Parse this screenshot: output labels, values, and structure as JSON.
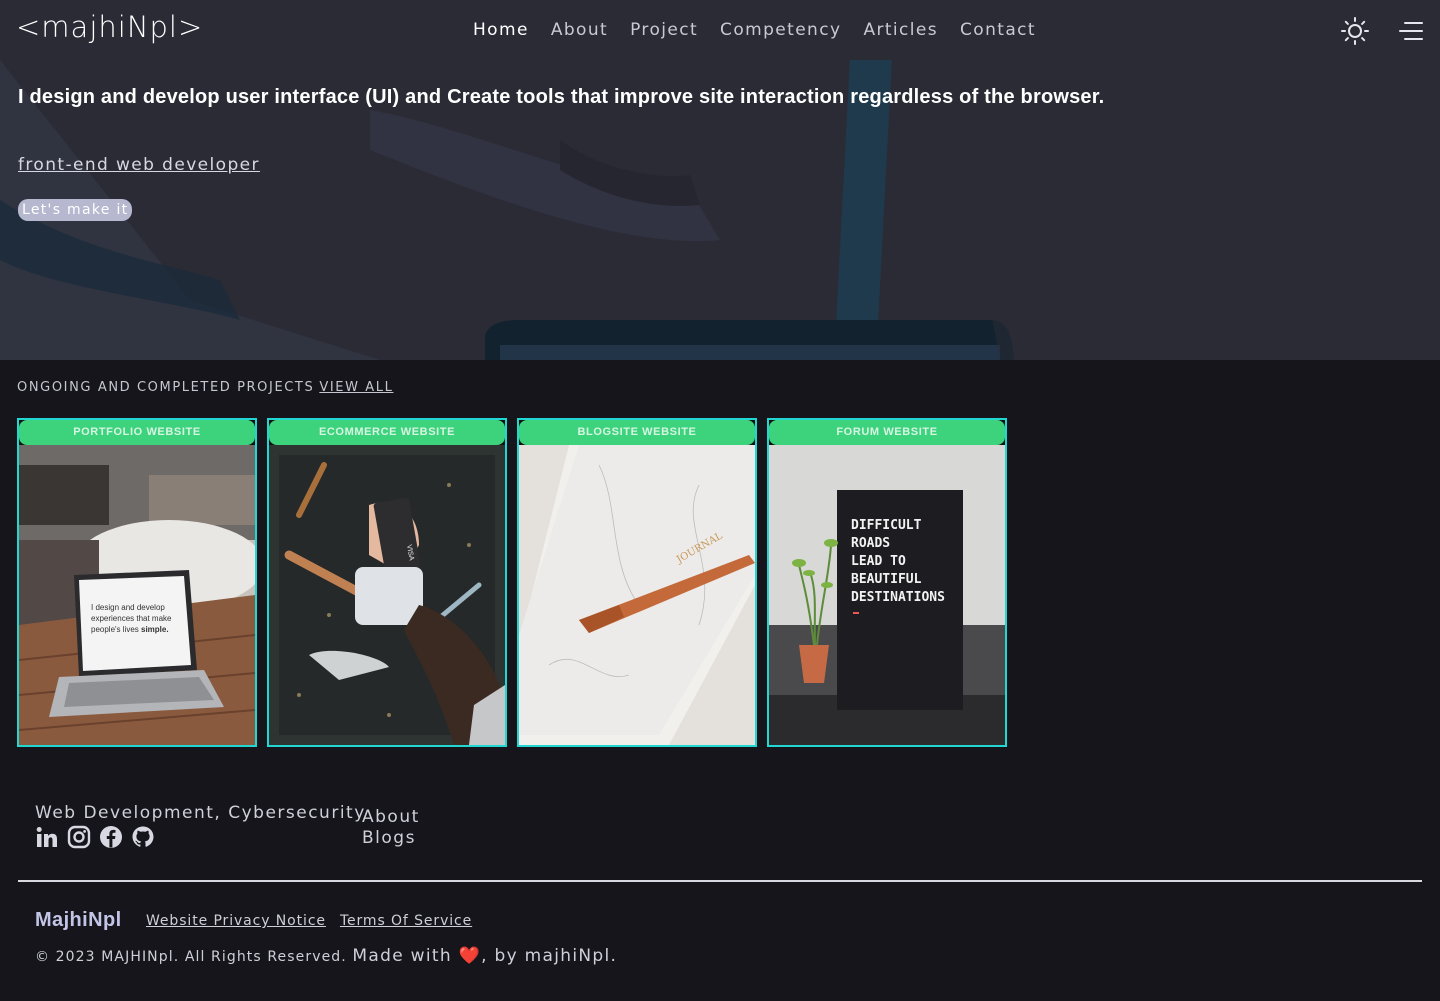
{
  "header": {
    "logo": "<majhiNpl>",
    "nav": [
      "Home",
      "About",
      "Project",
      "Competency",
      "Articles",
      "Contact"
    ],
    "active_nav": "Home",
    "icons": {
      "theme": "sun-icon",
      "menu": "menu-icon"
    }
  },
  "hero": {
    "headline": "I design and develop user interface (UI) and Create tools that improve site interaction regardless of the browser.",
    "role": "front-end web developer",
    "cta": "Let's make it"
  },
  "projects": {
    "heading": "ONGOING AND COMPLETED PROJECTS",
    "view_all": "VIEW ALL",
    "items": [
      {
        "label": "PORTFOLIO WEBSITE",
        "image": "laptop-on-table",
        "image_text": "I design and develop experiences that make people's lives simple."
      },
      {
        "label": "ECOMMERCE WEBSITE",
        "image": "card-payment-workbench",
        "image_text": "VISA"
      },
      {
        "label": "BLOGSITE WEBSITE",
        "image": "journal-and-pen",
        "image_text": "JOURNAL"
      },
      {
        "label": "FORUM WEBSITE",
        "image": "letterboard-and-plant",
        "image_text": "DIFFICULT ROADS LEAD TO BEAUTIFUL DESTINATIONS"
      }
    ]
  },
  "footer": {
    "tagline": "Web Development, Cybersecurity",
    "social_icons": [
      "linkedin-icon",
      "instagram-icon",
      "facebook-icon",
      "github-icon"
    ],
    "links": [
      "About",
      "Blogs"
    ],
    "brand": "MajhiNpl",
    "legal": [
      "Website Privacy Notice",
      "Terms Of Service"
    ],
    "copyright": "© 2023 MAJHINpl. All Rights Reserved.",
    "made_with": "Made with ❤️, by majhiNpl.",
    "accent": "#22d7d2",
    "tag_color": "#3dd37d"
  }
}
